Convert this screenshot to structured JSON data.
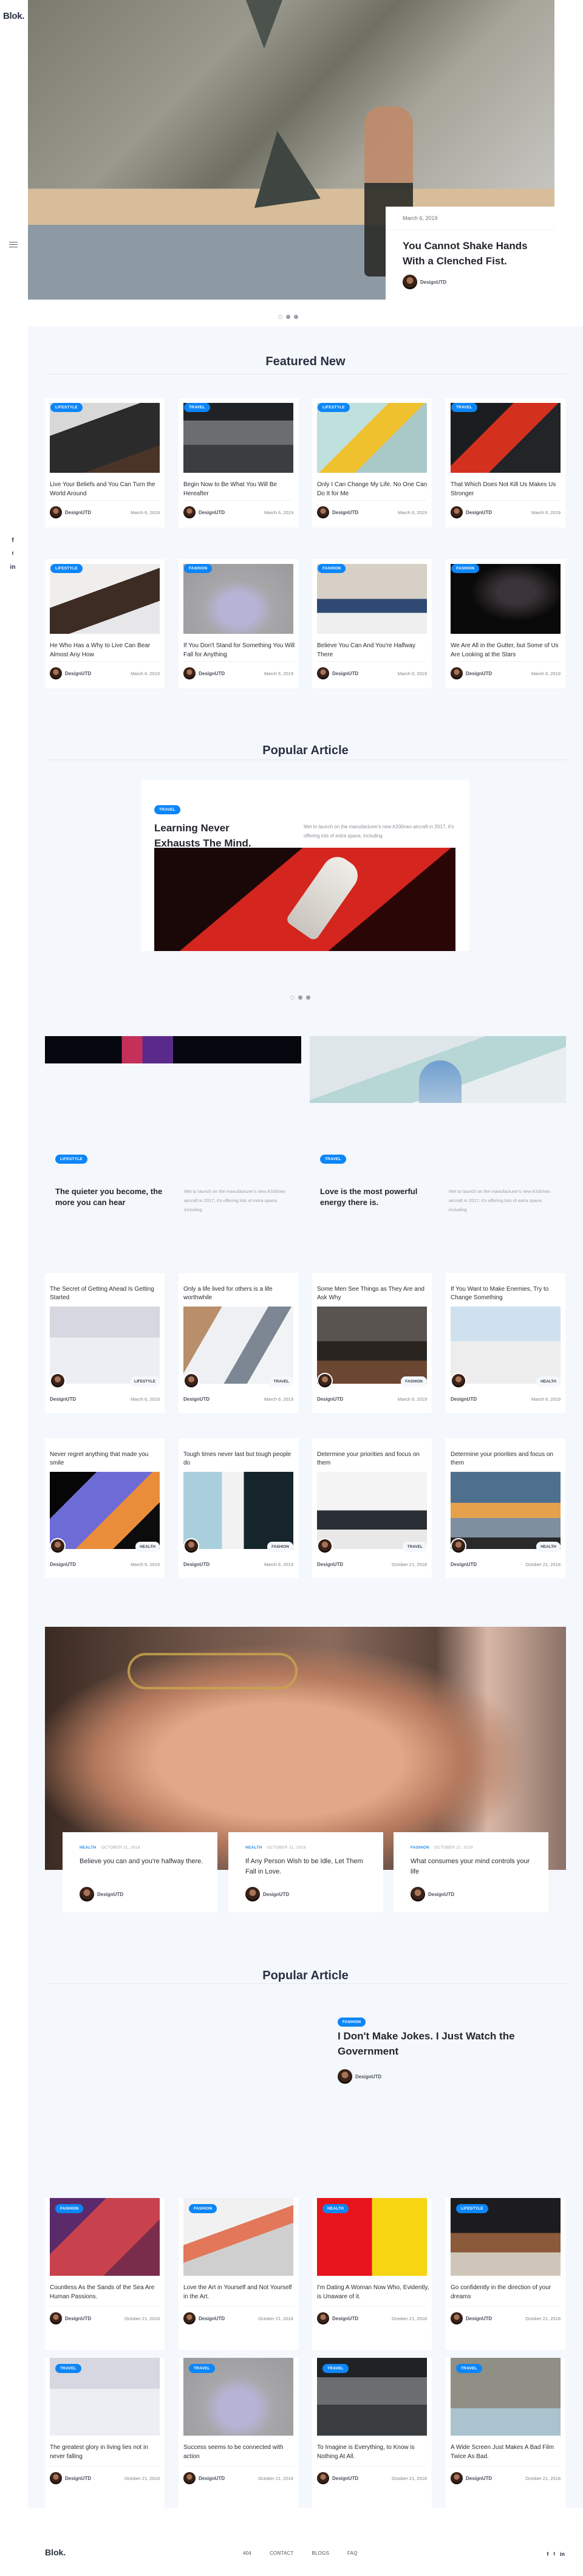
{
  "brand": {
    "logo": "Blok."
  },
  "sidebar": {
    "menu_icon": "hamburger-icon",
    "social": [
      {
        "icon": "facebook-icon",
        "glyph": "f"
      },
      {
        "icon": "twitter-icon",
        "glyph": "🐦"
      },
      {
        "icon": "linkedin-icon",
        "glyph": "in"
      }
    ]
  },
  "hero": {
    "date": "March 6, 2019",
    "title": "You Cannot Shake Hands With a Clenched Fist.",
    "author": "DesignUTD",
    "slides": 3,
    "active_slide": 1
  },
  "featured": {
    "title": "Featured New",
    "cards": [
      {
        "category": "LIFESTYLE",
        "title": "Live Your Beliefs and You Can Turn the World Around",
        "author": "DesignUTD",
        "date": "March 6, 2019"
      },
      {
        "category": "TRAVEL",
        "title": "Begin Now to Be What You Will Be Hereafter",
        "author": "DesignUTD",
        "date": "March 6, 2019"
      },
      {
        "category": "LIFESTYLE",
        "title": "Only I Can Change My Life. No One Can Do It for Me",
        "author": "DesignUTD",
        "date": "March 6, 2019"
      },
      {
        "category": "TRAVEL",
        "title": "That Which Does Not Kill Us Makes Us Stronger",
        "author": "DesignUTD",
        "date": "March 6, 2019"
      },
      {
        "category": "LIFESTYLE",
        "title": "He Who Has a Why to Live Can Bear Almost Any How",
        "author": "DesignUTD",
        "date": "March 6, 2019"
      },
      {
        "category": "FASHION",
        "title": "If You Don't Stand for Something You Will Fall for Anything",
        "author": "DesignUTD",
        "date": "March 6, 2019"
      },
      {
        "category": "FASHION",
        "title": "Believe You Can And You're Halfway There",
        "author": "DesignUTD",
        "date": "March 6, 2019"
      },
      {
        "category": "FASHION",
        "title": "We Are All in the Gutter, but Some of Us Are Looking at the Stars",
        "author": "DesignUTD",
        "date": "March 6, 2019"
      }
    ]
  },
  "popular": {
    "title": "Popular Article",
    "slide": {
      "category": "TRAVEL",
      "title": "Learning Never Exhausts The Mind.",
      "description": "Met to launch on the manufacturer's new A330neo aircraft in 2017, it's offering lots of extra space, including"
    },
    "slides": 3,
    "active_slide": 1
  },
  "split": [
    {
      "category": "LIFESTYLE",
      "title": "The quieter you become, the more you can hear",
      "description": "Met to launch on the manufacturer's new A330neo aircraft in 2017, it's offering lots of extra space, including"
    },
    {
      "category": "TRAVEL",
      "title": "Love is the most powerful energy there is.",
      "description": "Met to launch on the manufacturer's new A330neo aircraft in 2017, it's offering lots of extra space, including"
    }
  ],
  "grid": [
    {
      "title": "The Secret of Getting Ahead Is Getting Started",
      "category": "LIFESTYLE",
      "author": "DesignUTD",
      "date": "March 6, 2019"
    },
    {
      "title": "Only a life lived for others is a life worthwhile",
      "category": "TRAVEL",
      "author": "DesignUTD",
      "date": "March 6, 2019"
    },
    {
      "title": "Some Men See Things as They Are and Ask Why",
      "category": "FASHION",
      "author": "DesignUTD",
      "date": "March 6, 2019"
    },
    {
      "title": "If You Want to Make Enemies, Try to Change Something",
      "category": "HEALTH",
      "author": "DesignUTD",
      "date": "March 6, 2019"
    },
    {
      "title": "Never regret anything that made you smile",
      "category": "HEALTH",
      "author": "DesignUTD",
      "date": "March 6, 2019"
    },
    {
      "title": "Tough times never last but tough people do",
      "category": "FASHION",
      "author": "DesignUTD",
      "date": "March 6, 2019"
    },
    {
      "title": "Determine your priorities and focus on them",
      "category": "TRAVEL",
      "author": "DesignUTD",
      "date": "October 21, 2018"
    },
    {
      "title": "Determine your priorities and focus on them",
      "category": "HEALTH",
      "author": "DesignUTD",
      "date": "October 21, 2018"
    }
  ],
  "overlay_cards": [
    {
      "category": "HEALTH",
      "date": "OCTOBER 21, 2018",
      "title": "Believe you can and you're halfway there.",
      "author": "DesignUTD"
    },
    {
      "category": "HEALTH",
      "date": "OCTOBER 21, 2018",
      "title": "If Any Person Wish to be Idle, Let Them Fall in Love.",
      "author": "DesignUTD"
    },
    {
      "category": "FASHION",
      "date": "OCTOBER 21, 2018",
      "title": "What consumes your mind controls your life",
      "author": "DesignUTD"
    }
  ],
  "popular2": {
    "title": "Popular Article",
    "category": "FASHION",
    "headline": "I Don't Make Jokes. I Just Watch the Government",
    "author": "DesignUTD"
  },
  "bottom": [
    {
      "category": "FASHION",
      "title": "Countless As the Sands of the Sea Are Human Passions.",
      "author": "DesignUTD",
      "date": "October 21, 2018"
    },
    {
      "category": "FASHION",
      "title": "Love the Art in Yourself and Not Yourself in the Art.",
      "author": "DesignUTD",
      "date": "October 21, 2018"
    },
    {
      "category": "HEALTH",
      "title": "I'm Dating A Woman Now Who, Evidently, is Unaware of it.",
      "author": "DesignUTD",
      "date": "October 21, 2018"
    },
    {
      "category": "LIFESTYLE",
      "title": "Go confidently in the direction of your dreams",
      "author": "DesignUTD",
      "date": "October 21, 2018"
    },
    {
      "category": "TRAVEL",
      "title": "The greatest glory in living lies not in never falling",
      "author": "DesignUTD",
      "date": "October 21, 2018"
    },
    {
      "category": "TRAVEL",
      "title": "Success seems to be connected with action",
      "author": "DesignUTD",
      "date": "October 21, 2018"
    },
    {
      "category": "TRAVEL",
      "title": "To Imagine is Everything, to Know is Nothing At All.",
      "author": "DesignUTD",
      "date": "October 21, 2018"
    },
    {
      "category": "TRAVEL",
      "title": "A Wide Screen Just Makes A Bad Film Twice As Bad.",
      "author": "DesignUTD",
      "date": "October 21, 2018"
    }
  ],
  "footer": {
    "logo": "Blok.",
    "nav": [
      "404",
      "CONTACT",
      "BLOGS",
      "FAQ"
    ],
    "social": [
      "f",
      "🐦",
      "in"
    ]
  },
  "colors": {
    "accent": "#0c86f7",
    "page_bg": "#f4f7fc",
    "heading": "#2a3042"
  }
}
